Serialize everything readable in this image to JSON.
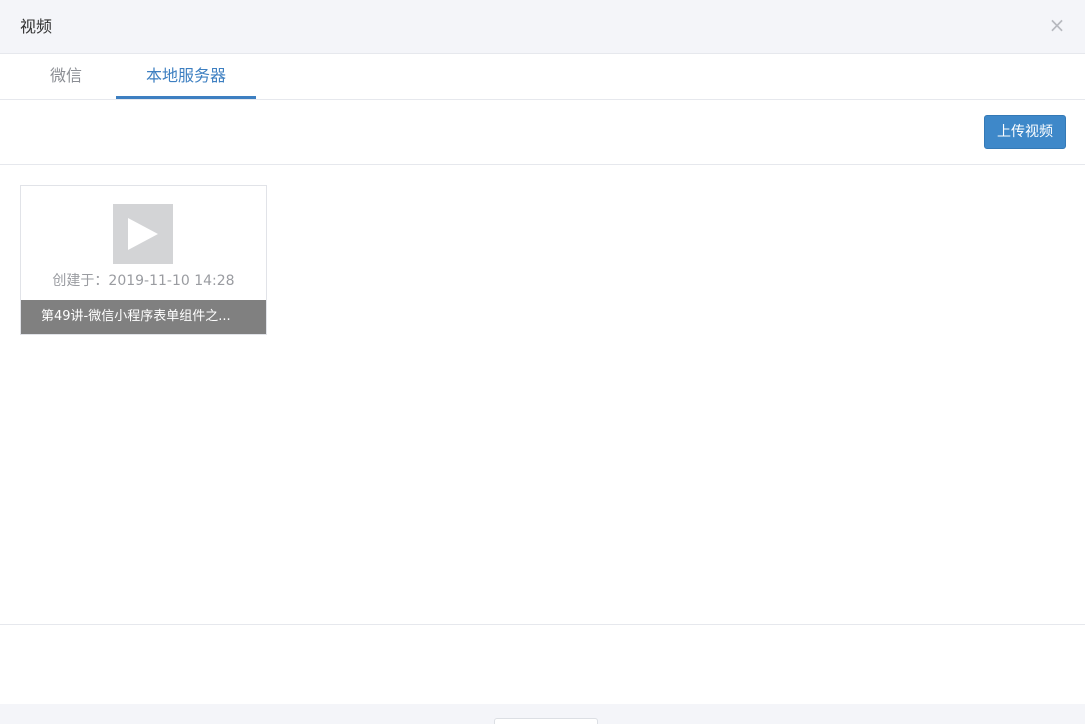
{
  "dialog": {
    "title": "视频",
    "close_glyph": "×"
  },
  "tabs": [
    {
      "label": "微信",
      "active": false
    },
    {
      "label": "本地服务器",
      "active": true
    }
  ],
  "toolbar": {
    "upload_label": "上传视频"
  },
  "videos": [
    {
      "created_text": "创建于：2019-11-10 14:28",
      "title": "第49讲-微信小程序表单组件之..."
    }
  ],
  "icons": {
    "close": "close-icon",
    "play": "play-icon"
  },
  "colors": {
    "accent": "#3d7fc1",
    "button": "#3e88c9",
    "header_bg": "#f4f5f9",
    "card_title_bg": "#808080"
  }
}
